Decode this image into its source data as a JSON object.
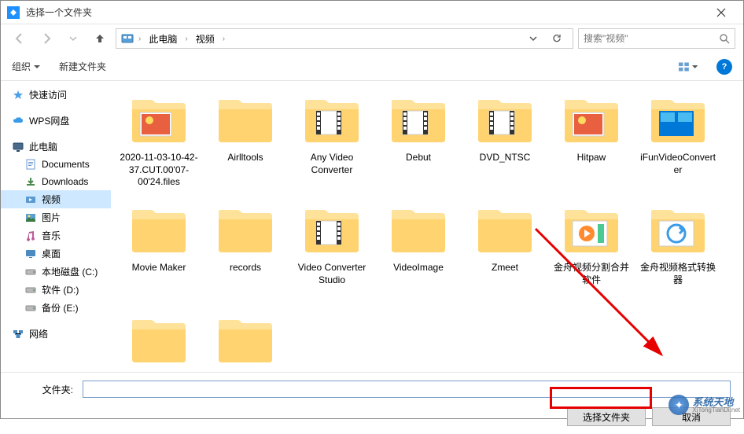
{
  "window": {
    "title": "选择一个文件夹"
  },
  "nav": {
    "breadcrumbs": [
      "此电脑",
      "视频"
    ],
    "search_placeholder": "搜索\"视频\""
  },
  "toolbar": {
    "organize": "组织",
    "new_folder": "新建文件夹"
  },
  "sidebar": {
    "quick_access": "快速访问",
    "wps": "WPS网盘",
    "this_pc": "此电脑",
    "items": [
      {
        "label": "Documents",
        "icon": "doc"
      },
      {
        "label": "Downloads",
        "icon": "down"
      },
      {
        "label": "视频",
        "icon": "video",
        "selected": true
      },
      {
        "label": "图片",
        "icon": "pic"
      },
      {
        "label": "音乐",
        "icon": "music"
      },
      {
        "label": "桌面",
        "icon": "desktop"
      },
      {
        "label": "本地磁盘 (C:)",
        "icon": "drive"
      },
      {
        "label": "软件 (D:)",
        "icon": "drive"
      },
      {
        "label": "备份 (E:)",
        "icon": "drive"
      }
    ],
    "network": "网络"
  },
  "folders": [
    {
      "label": "2020-11-03-10-42-37.CUT.00'07-00'24.files",
      "thumb": "photo"
    },
    {
      "label": "Airlltools",
      "thumb": ""
    },
    {
      "label": "Any Video Converter",
      "thumb": "film"
    },
    {
      "label": "Debut",
      "thumb": "film"
    },
    {
      "label": "DVD_NTSC",
      "thumb": "film"
    },
    {
      "label": "Hitpaw",
      "thumb": "photo"
    },
    {
      "label": "iFunVideoConverter",
      "thumb": "desktop"
    },
    {
      "label": "Movie Maker",
      "thumb": ""
    },
    {
      "label": "records",
      "thumb": ""
    },
    {
      "label": "Video Converter Studio",
      "thumb": "film"
    },
    {
      "label": "VideoImage",
      "thumb": ""
    },
    {
      "label": "Zmeet",
      "thumb": ""
    },
    {
      "label": "金舟视频分割合并软件",
      "thumb": "play"
    },
    {
      "label": "金舟视频格式转换器",
      "thumb": "convert"
    },
    {
      "label": "",
      "thumb": ""
    },
    {
      "label": "",
      "thumb": ""
    }
  ],
  "bottom": {
    "folder_label": "文件夹:",
    "select_button": "选择文件夹",
    "cancel_button": "取消"
  },
  "watermark": {
    "cn": "系统天地",
    "en": "XiTongTianDi.net"
  }
}
